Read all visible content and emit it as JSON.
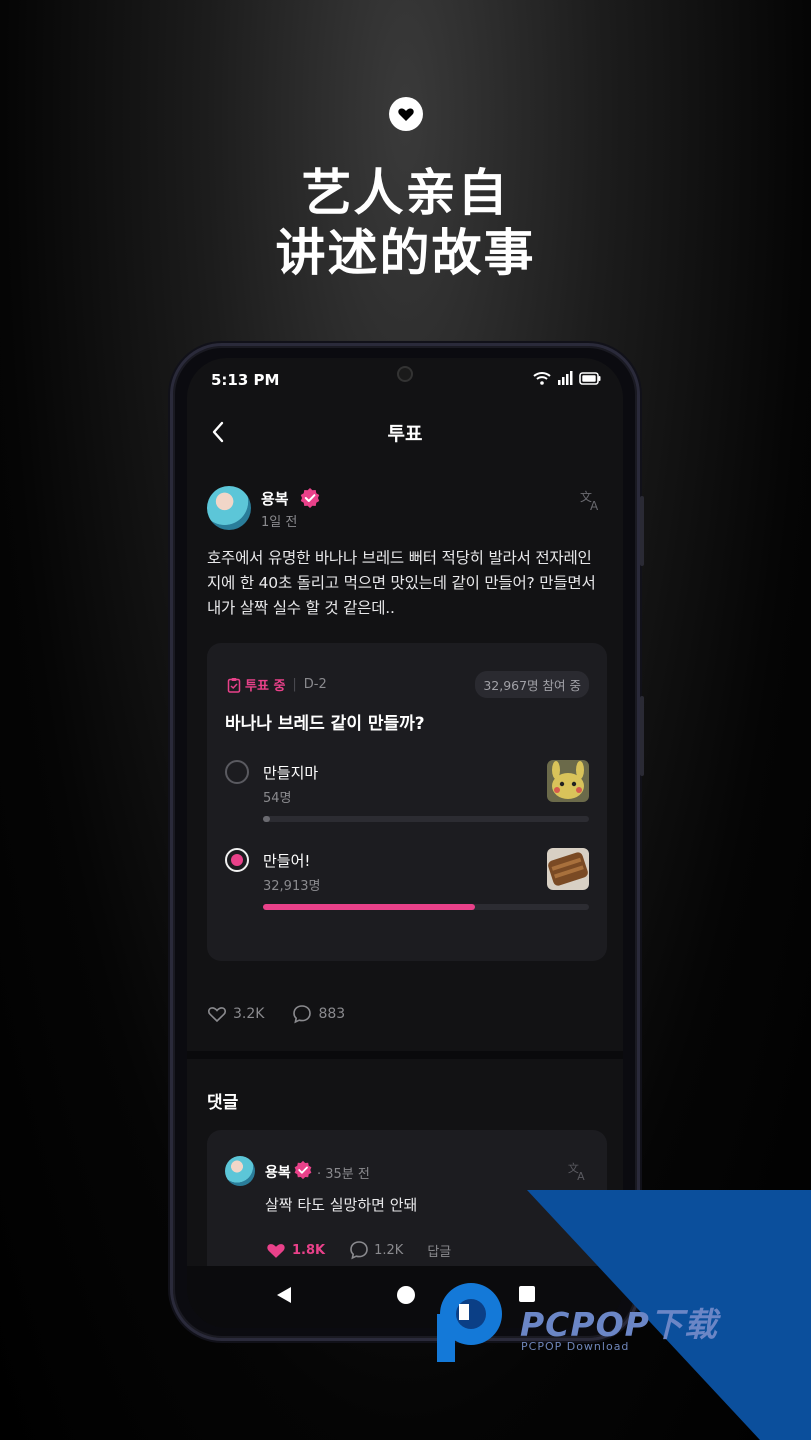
{
  "hero": {
    "title_line1": "艺人亲自",
    "title_line2": "讲述的故事",
    "icon": "heart-chat-icon"
  },
  "status_bar": {
    "time": "5:13 PM",
    "icons": [
      "wifi-icon",
      "signal-icon",
      "battery-icon"
    ]
  },
  "nav": {
    "title": "투표",
    "back_icon": "chevron-left-icon"
  },
  "post": {
    "author": "용복",
    "time": "1일 전",
    "body": "호주에서 유명한 바나나 브레드 뻐터 적당히 발라서 전자레인지에 한 40초 돌리고 먹으면 맛있는데 같이 만들어? 만들면서 내가 살짝 실수 할 것 같은데..",
    "likes": "3.2K",
    "comments": "883"
  },
  "poll": {
    "status": "투표 중",
    "dday": "D-2",
    "participants": "32,967명 참여 중",
    "question": "바나나 브레드 같이 만들까?",
    "options": [
      {
        "label": "만들지마",
        "count": "54명",
        "fraction": 0.02,
        "selected": false,
        "thumb": "pikachu-thumb"
      },
      {
        "label": "만들어!",
        "count": "32,913명",
        "fraction": 0.65,
        "selected": true,
        "thumb": "banana-bread-thumb"
      }
    ],
    "accent": "#e9418a"
  },
  "comments_section": {
    "title": "댓글",
    "comment": {
      "author": "용복",
      "time": "· 35분 전",
      "text": "살짝 타도 실망하면 안돼",
      "likes": "1.8K",
      "replies": "1.2K",
      "reply_label": "답글"
    }
  },
  "watermark": {
    "text": "PCPOP下载",
    "sub": "PCPOP Download",
    "color": "#0b4f9c"
  }
}
